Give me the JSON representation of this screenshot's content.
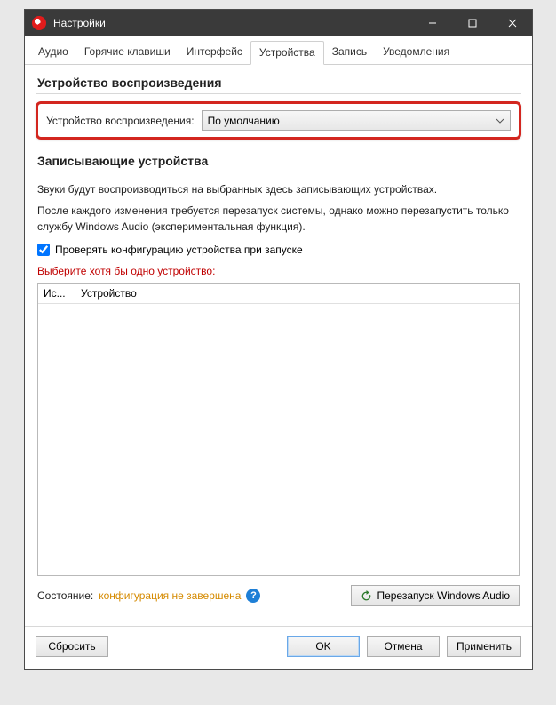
{
  "titlebar": {
    "title": "Настройки"
  },
  "tabs": {
    "items": [
      {
        "label": "Аудио"
      },
      {
        "label": "Горячие клавиши"
      },
      {
        "label": "Интерфейс"
      },
      {
        "label": "Устройства"
      },
      {
        "label": "Запись"
      },
      {
        "label": "Уведомления"
      }
    ],
    "activeIndex": 3
  },
  "playback": {
    "group_title": "Устройство воспроизведения",
    "label": "Устройство воспроизведения:",
    "selected": "По умолчанию"
  },
  "recording": {
    "group_title": "Записывающие устройства",
    "desc1": "Звуки будут воспроизводиться на выбранных здесь записывающих устройствах.",
    "desc2": "После каждого изменения требуется перезапуск системы, однако можно перезапустить только службу Windows Audio (экспериментальная функция).",
    "checkbox_label": "Проверять конфигурацию устройства при запуске",
    "checkbox_checked": true,
    "error_text": "Выберите хотя бы одно устройство:",
    "columns": {
      "c1": "Ис...",
      "c2": "Устройство"
    },
    "status_label": "Состояние:",
    "status_value": "конфигурация не завершена",
    "restart_button": "Перезапуск Windows Audio"
  },
  "footer": {
    "reset": "Сбросить",
    "ok": "OK",
    "cancel": "Отмена",
    "apply": "Применить"
  }
}
